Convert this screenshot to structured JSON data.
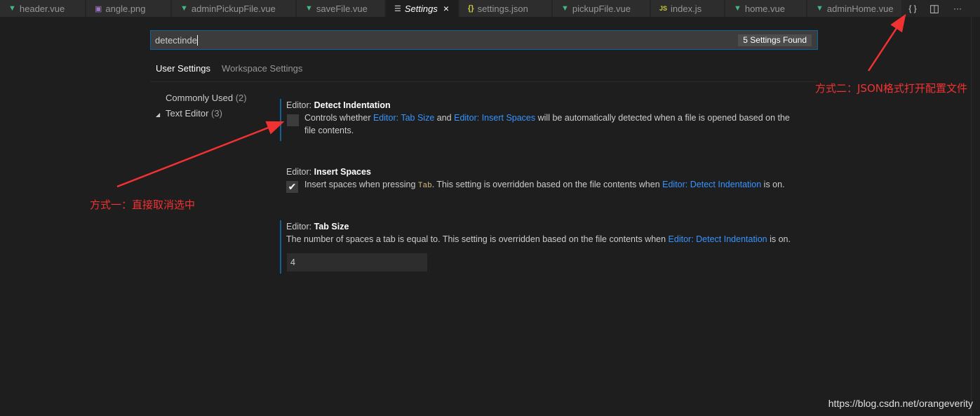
{
  "tabs": [
    {
      "label": "header.vue",
      "icon": "vue-icon"
    },
    {
      "label": "angle.png",
      "icon": "image-icon"
    },
    {
      "label": "adminPickupFile.vue",
      "icon": "vue-icon"
    },
    {
      "label": "saveFile.vue",
      "icon": "vue-icon"
    },
    {
      "label": "Settings",
      "icon": "settings-lines-icon",
      "active": true
    },
    {
      "label": "settings.json",
      "icon": "json-icon",
      "glyph": "{}"
    },
    {
      "label": "pickupFile.vue",
      "icon": "vue-icon"
    },
    {
      "label": "index.js",
      "icon": "js-icon",
      "glyph": "JS"
    },
    {
      "label": "home.vue",
      "icon": "vue-icon"
    },
    {
      "label": "adminHome.vue",
      "icon": "vue-icon"
    }
  ],
  "toolbar": {
    "open_json_glyph": "{ }",
    "split_glyph": "◫",
    "more_glyph": "···",
    "close_glyph": "×"
  },
  "search": {
    "value": "detectinde",
    "result_count": "5 Settings Found"
  },
  "scope_tabs": [
    "User Settings",
    "Workspace Settings"
  ],
  "toc": [
    {
      "label": "Commonly Used",
      "count": "(2)"
    },
    {
      "label": "Text Editor",
      "count": "(3)",
      "expanded": true
    }
  ],
  "settings": {
    "detect_indentation": {
      "category": "Editor: ",
      "name": "Detect Indentation",
      "desc_1": "Controls whether ",
      "link_1": "Editor: Tab Size",
      "desc_2": " and ",
      "link_2": "Editor: Insert Spaces",
      "desc_3": " will be automatically detected when a file is opened based on the",
      "desc_4": "file contents.",
      "checked": false
    },
    "insert_spaces": {
      "category": "Editor: ",
      "name": "Insert Spaces",
      "desc_1": "Insert spaces when pressing ",
      "code": "Tab",
      "desc_2": ". This setting is overridden based on the file contents when ",
      "link": "Editor: Detect Indentation",
      "desc_3": " is on.",
      "checked": true,
      "check_glyph": "✔"
    },
    "tab_size": {
      "category": "Editor: ",
      "name": "Tab Size",
      "desc_1": "The number of spaces a tab is equal to. This setting is overridden based on the file contents when ",
      "link": "Editor: Detect Indentation",
      "desc_2": " is on.",
      "value": "4"
    }
  },
  "annotations": {
    "method_one": "方式一：直接取消选中",
    "method_two": "方式二：JSON格式打开配置文件",
    "color": "#f23232"
  },
  "watermark": "https://blog.csdn.net/orangeverity",
  "colors": {
    "background": "#1e1e1e",
    "tab_inactive": "#2d2d2d",
    "accent": "#0e639c",
    "link": "#3794ff"
  }
}
